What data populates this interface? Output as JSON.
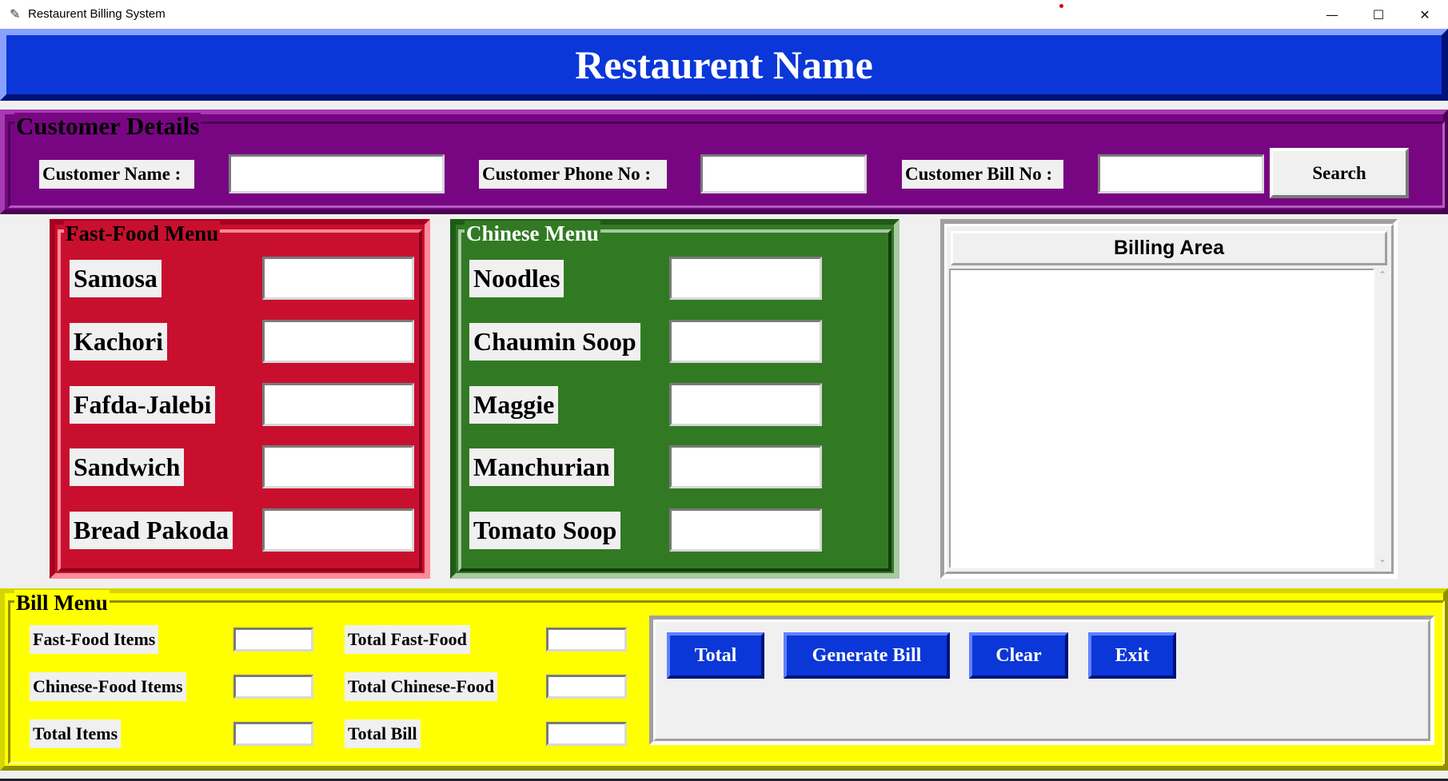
{
  "window": {
    "title": "Restaurent Billing System",
    "minimize": "—",
    "maximize": "☐",
    "close": "✕"
  },
  "header": {
    "title": "Restaurent Name"
  },
  "customer": {
    "section_title": "Customer Details",
    "name_label": "Customer Name :",
    "phone_label": "Customer Phone No :",
    "bill_label": "Customer Bill No :",
    "name_value": "",
    "phone_value": "",
    "bill_value": "",
    "search_label": "Search"
  },
  "fastfood": {
    "section_title": "Fast-Food Menu",
    "items": [
      {
        "label": "Samosa",
        "value": ""
      },
      {
        "label": "Kachori",
        "value": ""
      },
      {
        "label": "Fafda-Jalebi",
        "value": ""
      },
      {
        "label": "Sandwich",
        "value": ""
      },
      {
        "label": "Bread Pakoda",
        "value": ""
      }
    ]
  },
  "chinese": {
    "section_title": "Chinese Menu",
    "items": [
      {
        "label": "Noodles",
        "value": ""
      },
      {
        "label": "Chaumin Soop",
        "value": ""
      },
      {
        "label": "Maggie",
        "value": ""
      },
      {
        "label": "Manchurian",
        "value": ""
      },
      {
        "label": "Tomato Soop",
        "value": ""
      }
    ]
  },
  "billing": {
    "header": "Billing Area",
    "text": "",
    "scroll_up": "⌃",
    "scroll_down": "⌄"
  },
  "bill_menu": {
    "section_title": "Bill Menu",
    "labels": {
      "fastfood_items": "Fast-Food Items",
      "chinese_items": "Chinese-Food Items",
      "total_items": "Total Items",
      "total_fastfood": "Total Fast-Food",
      "total_chinese": "Total Chinese-Food",
      "total_bill": "Total Bill"
    },
    "buttons": {
      "total": "Total",
      "generate": "Generate Bill",
      "clear": "Clear",
      "exit": "Exit"
    }
  },
  "icons": {
    "app": "feather-icon",
    "app_glyph": "✎"
  },
  "colors": {
    "header_bg": "#0b37d8",
    "customer_bg": "#780683",
    "fastfood_bg": "#c8102e",
    "chinese_bg": "#317a23",
    "billmenu_bg": "#ffff00",
    "button_bg": "#0b37d8"
  }
}
